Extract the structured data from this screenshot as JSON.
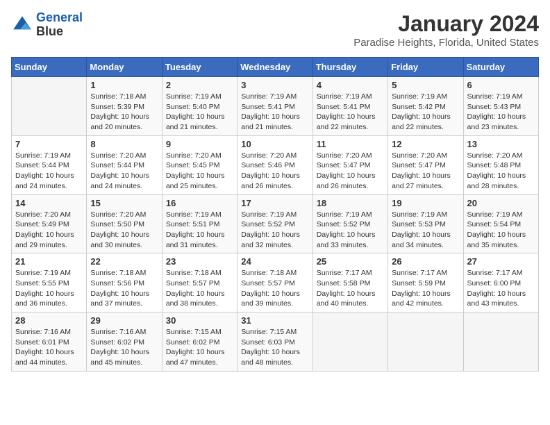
{
  "logo": {
    "line1": "General",
    "line2": "Blue"
  },
  "title": "January 2024",
  "subtitle": "Paradise Heights, Florida, United States",
  "headers": [
    "Sunday",
    "Monday",
    "Tuesday",
    "Wednesday",
    "Thursday",
    "Friday",
    "Saturday"
  ],
  "weeks": [
    [
      {
        "day": "",
        "sunrise": "",
        "sunset": "",
        "daylight": ""
      },
      {
        "day": "1",
        "sunrise": "Sunrise: 7:18 AM",
        "sunset": "Sunset: 5:39 PM",
        "daylight": "Daylight: 10 hours and 20 minutes."
      },
      {
        "day": "2",
        "sunrise": "Sunrise: 7:19 AM",
        "sunset": "Sunset: 5:40 PM",
        "daylight": "Daylight: 10 hours and 21 minutes."
      },
      {
        "day": "3",
        "sunrise": "Sunrise: 7:19 AM",
        "sunset": "Sunset: 5:41 PM",
        "daylight": "Daylight: 10 hours and 21 minutes."
      },
      {
        "day": "4",
        "sunrise": "Sunrise: 7:19 AM",
        "sunset": "Sunset: 5:41 PM",
        "daylight": "Daylight: 10 hours and 22 minutes."
      },
      {
        "day": "5",
        "sunrise": "Sunrise: 7:19 AM",
        "sunset": "Sunset: 5:42 PM",
        "daylight": "Daylight: 10 hours and 22 minutes."
      },
      {
        "day": "6",
        "sunrise": "Sunrise: 7:19 AM",
        "sunset": "Sunset: 5:43 PM",
        "daylight": "Daylight: 10 hours and 23 minutes."
      }
    ],
    [
      {
        "day": "7",
        "sunrise": "Sunrise: 7:19 AM",
        "sunset": "Sunset: 5:44 PM",
        "daylight": "Daylight: 10 hours and 24 minutes."
      },
      {
        "day": "8",
        "sunrise": "Sunrise: 7:20 AM",
        "sunset": "Sunset: 5:44 PM",
        "daylight": "Daylight: 10 hours and 24 minutes."
      },
      {
        "day": "9",
        "sunrise": "Sunrise: 7:20 AM",
        "sunset": "Sunset: 5:45 PM",
        "daylight": "Daylight: 10 hours and 25 minutes."
      },
      {
        "day": "10",
        "sunrise": "Sunrise: 7:20 AM",
        "sunset": "Sunset: 5:46 PM",
        "daylight": "Daylight: 10 hours and 26 minutes."
      },
      {
        "day": "11",
        "sunrise": "Sunrise: 7:20 AM",
        "sunset": "Sunset: 5:47 PM",
        "daylight": "Daylight: 10 hours and 26 minutes."
      },
      {
        "day": "12",
        "sunrise": "Sunrise: 7:20 AM",
        "sunset": "Sunset: 5:47 PM",
        "daylight": "Daylight: 10 hours and 27 minutes."
      },
      {
        "day": "13",
        "sunrise": "Sunrise: 7:20 AM",
        "sunset": "Sunset: 5:48 PM",
        "daylight": "Daylight: 10 hours and 28 minutes."
      }
    ],
    [
      {
        "day": "14",
        "sunrise": "Sunrise: 7:20 AM",
        "sunset": "Sunset: 5:49 PM",
        "daylight": "Daylight: 10 hours and 29 minutes."
      },
      {
        "day": "15",
        "sunrise": "Sunrise: 7:20 AM",
        "sunset": "Sunset: 5:50 PM",
        "daylight": "Daylight: 10 hours and 30 minutes."
      },
      {
        "day": "16",
        "sunrise": "Sunrise: 7:19 AM",
        "sunset": "Sunset: 5:51 PM",
        "daylight": "Daylight: 10 hours and 31 minutes."
      },
      {
        "day": "17",
        "sunrise": "Sunrise: 7:19 AM",
        "sunset": "Sunset: 5:52 PM",
        "daylight": "Daylight: 10 hours and 32 minutes."
      },
      {
        "day": "18",
        "sunrise": "Sunrise: 7:19 AM",
        "sunset": "Sunset: 5:52 PM",
        "daylight": "Daylight: 10 hours and 33 minutes."
      },
      {
        "day": "19",
        "sunrise": "Sunrise: 7:19 AM",
        "sunset": "Sunset: 5:53 PM",
        "daylight": "Daylight: 10 hours and 34 minutes."
      },
      {
        "day": "20",
        "sunrise": "Sunrise: 7:19 AM",
        "sunset": "Sunset: 5:54 PM",
        "daylight": "Daylight: 10 hours and 35 minutes."
      }
    ],
    [
      {
        "day": "21",
        "sunrise": "Sunrise: 7:19 AM",
        "sunset": "Sunset: 5:55 PM",
        "daylight": "Daylight: 10 hours and 36 minutes."
      },
      {
        "day": "22",
        "sunrise": "Sunrise: 7:18 AM",
        "sunset": "Sunset: 5:56 PM",
        "daylight": "Daylight: 10 hours and 37 minutes."
      },
      {
        "day": "23",
        "sunrise": "Sunrise: 7:18 AM",
        "sunset": "Sunset: 5:57 PM",
        "daylight": "Daylight: 10 hours and 38 minutes."
      },
      {
        "day": "24",
        "sunrise": "Sunrise: 7:18 AM",
        "sunset": "Sunset: 5:57 PM",
        "daylight": "Daylight: 10 hours and 39 minutes."
      },
      {
        "day": "25",
        "sunrise": "Sunrise: 7:17 AM",
        "sunset": "Sunset: 5:58 PM",
        "daylight": "Daylight: 10 hours and 40 minutes."
      },
      {
        "day": "26",
        "sunrise": "Sunrise: 7:17 AM",
        "sunset": "Sunset: 5:59 PM",
        "daylight": "Daylight: 10 hours and 42 minutes."
      },
      {
        "day": "27",
        "sunrise": "Sunrise: 7:17 AM",
        "sunset": "Sunset: 6:00 PM",
        "daylight": "Daylight: 10 hours and 43 minutes."
      }
    ],
    [
      {
        "day": "28",
        "sunrise": "Sunrise: 7:16 AM",
        "sunset": "Sunset: 6:01 PM",
        "daylight": "Daylight: 10 hours and 44 minutes."
      },
      {
        "day": "29",
        "sunrise": "Sunrise: 7:16 AM",
        "sunset": "Sunset: 6:02 PM",
        "daylight": "Daylight: 10 hours and 45 minutes."
      },
      {
        "day": "30",
        "sunrise": "Sunrise: 7:15 AM",
        "sunset": "Sunset: 6:02 PM",
        "daylight": "Daylight: 10 hours and 47 minutes."
      },
      {
        "day": "31",
        "sunrise": "Sunrise: 7:15 AM",
        "sunset": "Sunset: 6:03 PM",
        "daylight": "Daylight: 10 hours and 48 minutes."
      },
      {
        "day": "",
        "sunrise": "",
        "sunset": "",
        "daylight": ""
      },
      {
        "day": "",
        "sunrise": "",
        "sunset": "",
        "daylight": ""
      },
      {
        "day": "",
        "sunrise": "",
        "sunset": "",
        "daylight": ""
      }
    ]
  ]
}
